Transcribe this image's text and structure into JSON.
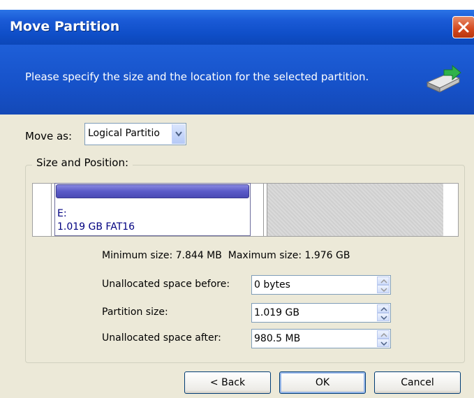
{
  "window": {
    "title": "Move Partition"
  },
  "header": {
    "text": "Please specify the size and the location for the selected partition."
  },
  "move_as": {
    "label": "Move as:",
    "value": "Logical Partitio"
  },
  "group": {
    "label": "Size and Position:"
  },
  "partition": {
    "drive": "E:",
    "info": "1.019 GB  FAT16"
  },
  "sizes": {
    "min": "Minimum size: 7.844 MB",
    "max": "Maximum size: 1.976 GB"
  },
  "fields": [
    {
      "label": "Unallocated space before:",
      "value": "0 bytes"
    },
    {
      "label": "Partition size:",
      "value": "1.019 GB"
    },
    {
      "label": "Unallocated space after:",
      "value": "980.5 MB"
    }
  ],
  "buttons": {
    "back": "< Back",
    "ok": "OK",
    "cancel": "Cancel"
  },
  "colors": {
    "titlebar": "#0c47b8",
    "header": "#1651c8",
    "partition_bar": "#5a5ac8",
    "close": "#d3471d"
  }
}
